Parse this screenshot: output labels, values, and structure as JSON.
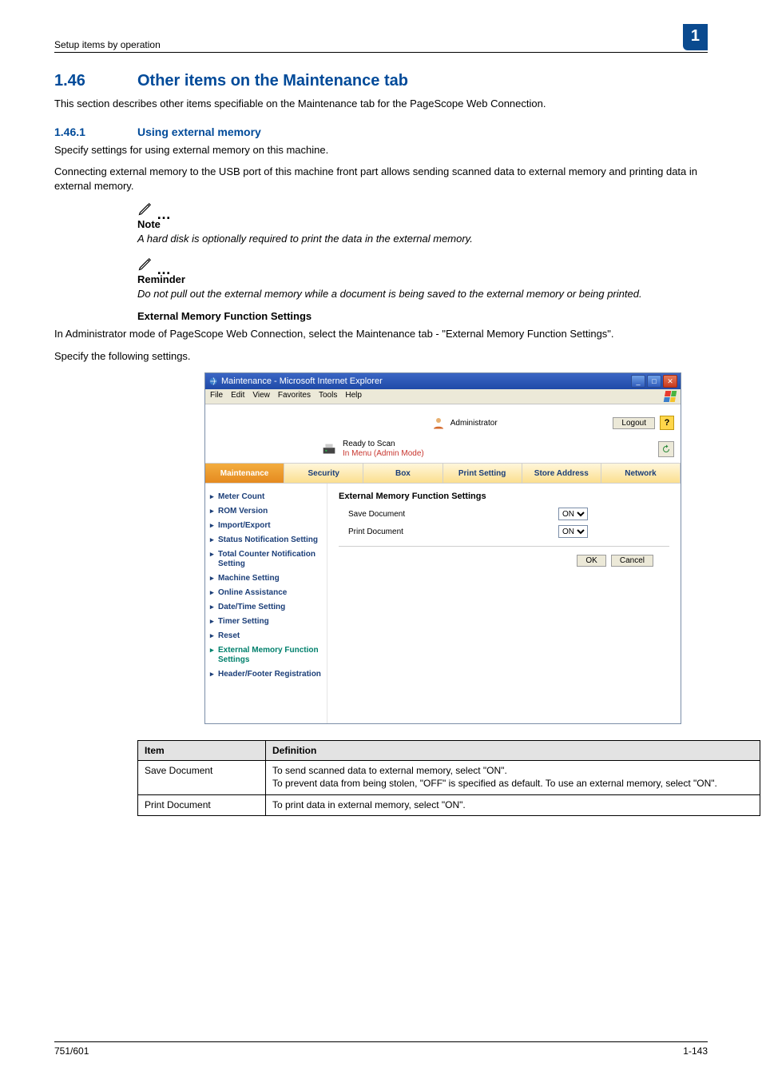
{
  "breadcrumb": "Setup items by operation",
  "chapter_badge": "1",
  "h1_num": "1.46",
  "h1_title": "Other items on the Maintenance tab",
  "h1_intro": "This section describes other items specifiable on the Maintenance tab for the PageScope Web Connection.",
  "h2_num": "1.46.1",
  "h2_title": "Using external memory",
  "h2_p1": "Specify settings for using external memory on this machine.",
  "h2_p2": "Connecting external memory to the USB port of this machine front part allows sending scanned data to external memory and printing data in external memory.",
  "note1_label": "Note",
  "note1_text": "A hard disk is optionally required to print the data in the external memory.",
  "note2_label": "Reminder",
  "note2_text": "Do not pull out the external memory while a document is being saved to the external memory or being printed.",
  "subhead": "External Memory Function Settings",
  "sub_p1": "In Administrator mode of PageScope Web Connection, select the Maintenance tab - \"External Memory Function Settings\".",
  "sub_p2": "Specify the following settings.",
  "screenshot": {
    "window_title": "Maintenance - Microsoft Internet Explorer",
    "menu": {
      "file": "File",
      "edit": "Edit",
      "view": "View",
      "favorites": "Favorites",
      "tools": "Tools",
      "help": "Help"
    },
    "mode_label": "Administrator",
    "logout": "Logout",
    "status_ready": "Ready to Scan",
    "status_mode": "In Menu (Admin Mode)",
    "tabs": {
      "maintenance": "Maintenance",
      "security": "Security",
      "box": "Box",
      "print": "Print Setting",
      "store": "Store Address",
      "network": "Network"
    },
    "side_items": [
      "Meter Count",
      "ROM Version",
      "Import/Export",
      "Status Notification Setting",
      "Total Counter Notification Setting",
      "Machine Setting",
      "Online Assistance",
      "Date/Time Setting",
      "Timer Setting",
      "Reset",
      "External Memory Function Settings",
      "Header/Footer Registration"
    ],
    "side_selected_index": 10,
    "main_title": "External Memory Function Settings",
    "fields": {
      "save_label": "Save Document",
      "save_value": "ON",
      "print_label": "Print Document",
      "print_value": "ON"
    },
    "buttons": {
      "ok": "OK",
      "cancel": "Cancel"
    }
  },
  "deftable": {
    "head_item": "Item",
    "head_def": "Definition",
    "rows": [
      {
        "item": "Save Document",
        "def": "To send scanned data to external memory, select \"ON\".\nTo prevent data from being stolen, \"OFF\" is specified as default. To use an external memory, select \"ON\"."
      },
      {
        "item": "Print Document",
        "def": "To print data in external memory, select \"ON\"."
      }
    ]
  },
  "footer_left": "751/601",
  "footer_right": "1-143"
}
